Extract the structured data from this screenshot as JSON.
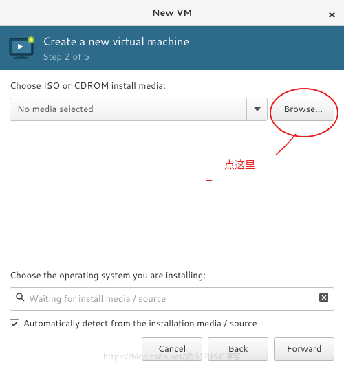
{
  "window": {
    "title": "New VM",
    "close": "×"
  },
  "header": {
    "title": "Create a new virtual machine",
    "step": "Step 2 of 5"
  },
  "media": {
    "label": "Choose ISO or CDROM install media:",
    "selected": "No media selected",
    "browse": "Browse..."
  },
  "annotation": {
    "text": "点这里"
  },
  "os": {
    "label": "Choose the operating system you are installing:",
    "placeholder": "Waiting for install media / source",
    "autodetect": "Automatically detect from the installation media / source"
  },
  "footer": {
    "cancel": "Cancel",
    "back": "Back",
    "forward": "Forward"
  },
  "watermark": "https://blog.csdn.net/@51RISC博客"
}
